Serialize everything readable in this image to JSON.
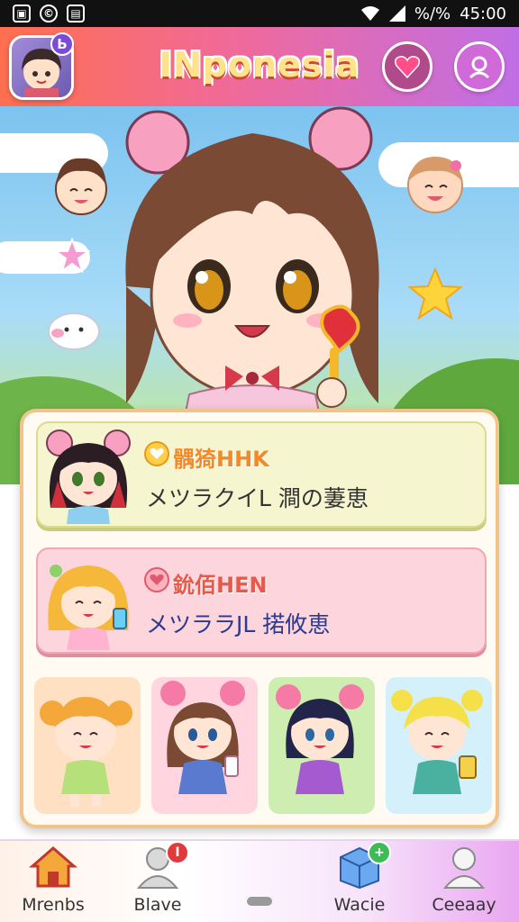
{
  "status_bar": {
    "left_icons": [
      "image-icon",
      "copyright-icon",
      "gallery-icon"
    ],
    "right_icons": [
      "wifi-icon",
      "signal-icon"
    ],
    "battery_text": "%/%",
    "time": "45:00"
  },
  "header": {
    "title": "INponesia",
    "avatar_badge": "Ь",
    "heart_icon": "heart-icon",
    "profile_icon": "profile-icon"
  },
  "cards": [
    {
      "title": "髃猗HHK",
      "subtitle": "メツラクイL 澗の萋恵",
      "icon": "heart-icon",
      "accent": "#f08a2a"
    },
    {
      "title": "鈗佰HEN",
      "subtitle": "メツララJL 掿攸恵",
      "icon": "heart-icon",
      "accent": "#e65a4a"
    }
  ],
  "tiles": [
    {
      "name": "character-tile-1",
      "bg": "#ffe0c2"
    },
    {
      "name": "character-tile-2",
      "bg": "#ffd6df"
    },
    {
      "name": "character-tile-3",
      "bg": "#cdeeb0"
    },
    {
      "name": "character-tile-4",
      "bg": "#d4f0fb"
    }
  ],
  "bottom_nav": [
    {
      "label": "Mrenbs",
      "icon": "house-icon",
      "badge": ""
    },
    {
      "label": "Blave",
      "icon": "person-icon",
      "badge": "I"
    },
    {
      "label": "Wacie",
      "icon": "box-icon",
      "badge": "+"
    },
    {
      "label": "Ceeaay",
      "icon": "user-icon",
      "badge": ""
    }
  ],
  "colors": {
    "header_start": "#ff6f4f",
    "header_end": "#c06ee6",
    "title": "#ffe38a",
    "panel_border": "#f0c48a"
  }
}
